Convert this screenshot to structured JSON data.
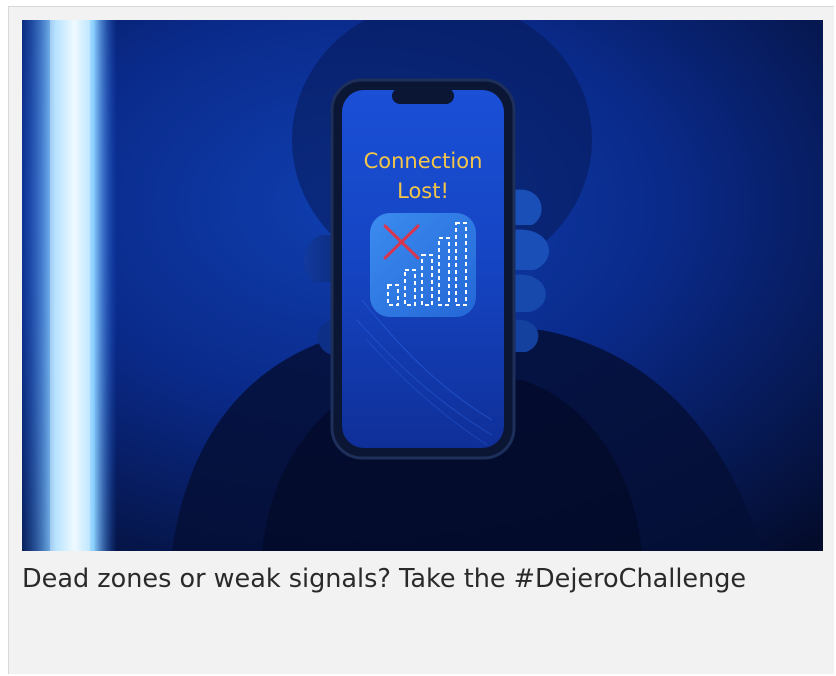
{
  "card": {
    "phone_screen": {
      "headline_line1": "Connection",
      "headline_line2": "Lost!",
      "icon": "no-signal-icon"
    },
    "caption": "Dead zones or weak signals? Take the #DejeroChallenge"
  },
  "colors": {
    "background_blue": "#0a2a8a",
    "neon_light": "#bfe8ff",
    "headline_yellow": "#f3c64a",
    "app_tile_blue": "#2f7fe6",
    "cross_red": "#d8354f",
    "caption_text": "#2a2a2a"
  }
}
